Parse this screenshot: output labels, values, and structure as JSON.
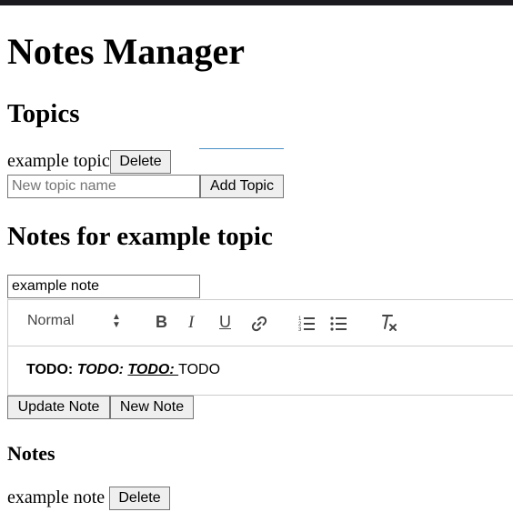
{
  "page_title": "Notes Manager",
  "topics": {
    "heading": "Topics",
    "items": [
      {
        "name": "example topic",
        "delete_label": "Delete"
      }
    ],
    "new_topic_placeholder": "New topic name",
    "add_label": "Add Topic"
  },
  "notes_section": {
    "heading": "Notes for example topic",
    "note_title_value": "example note",
    "toolbar": {
      "format_value": "Normal",
      "icons": [
        "bold-icon",
        "italic-icon",
        "underline-icon",
        "link-icon",
        "ordered-list-icon",
        "bullet-list-icon",
        "clear-format-icon"
      ]
    },
    "editor": {
      "seg1": "TODO: ",
      "seg2": "TODO: ",
      "seg3": "TODO: ",
      "seg4": "TODO"
    },
    "update_label": "Update Note",
    "new_label": "New Note"
  },
  "notes_list": {
    "heading": "Notes",
    "items": [
      {
        "name": "example note",
        "delete_label": "Delete"
      }
    ]
  },
  "colors": {
    "topbar": "#1b1b1f",
    "button_bg": "#efefef",
    "border": "#767676",
    "editor_border": "#cccccc",
    "link_underline": "#4a90c8"
  }
}
